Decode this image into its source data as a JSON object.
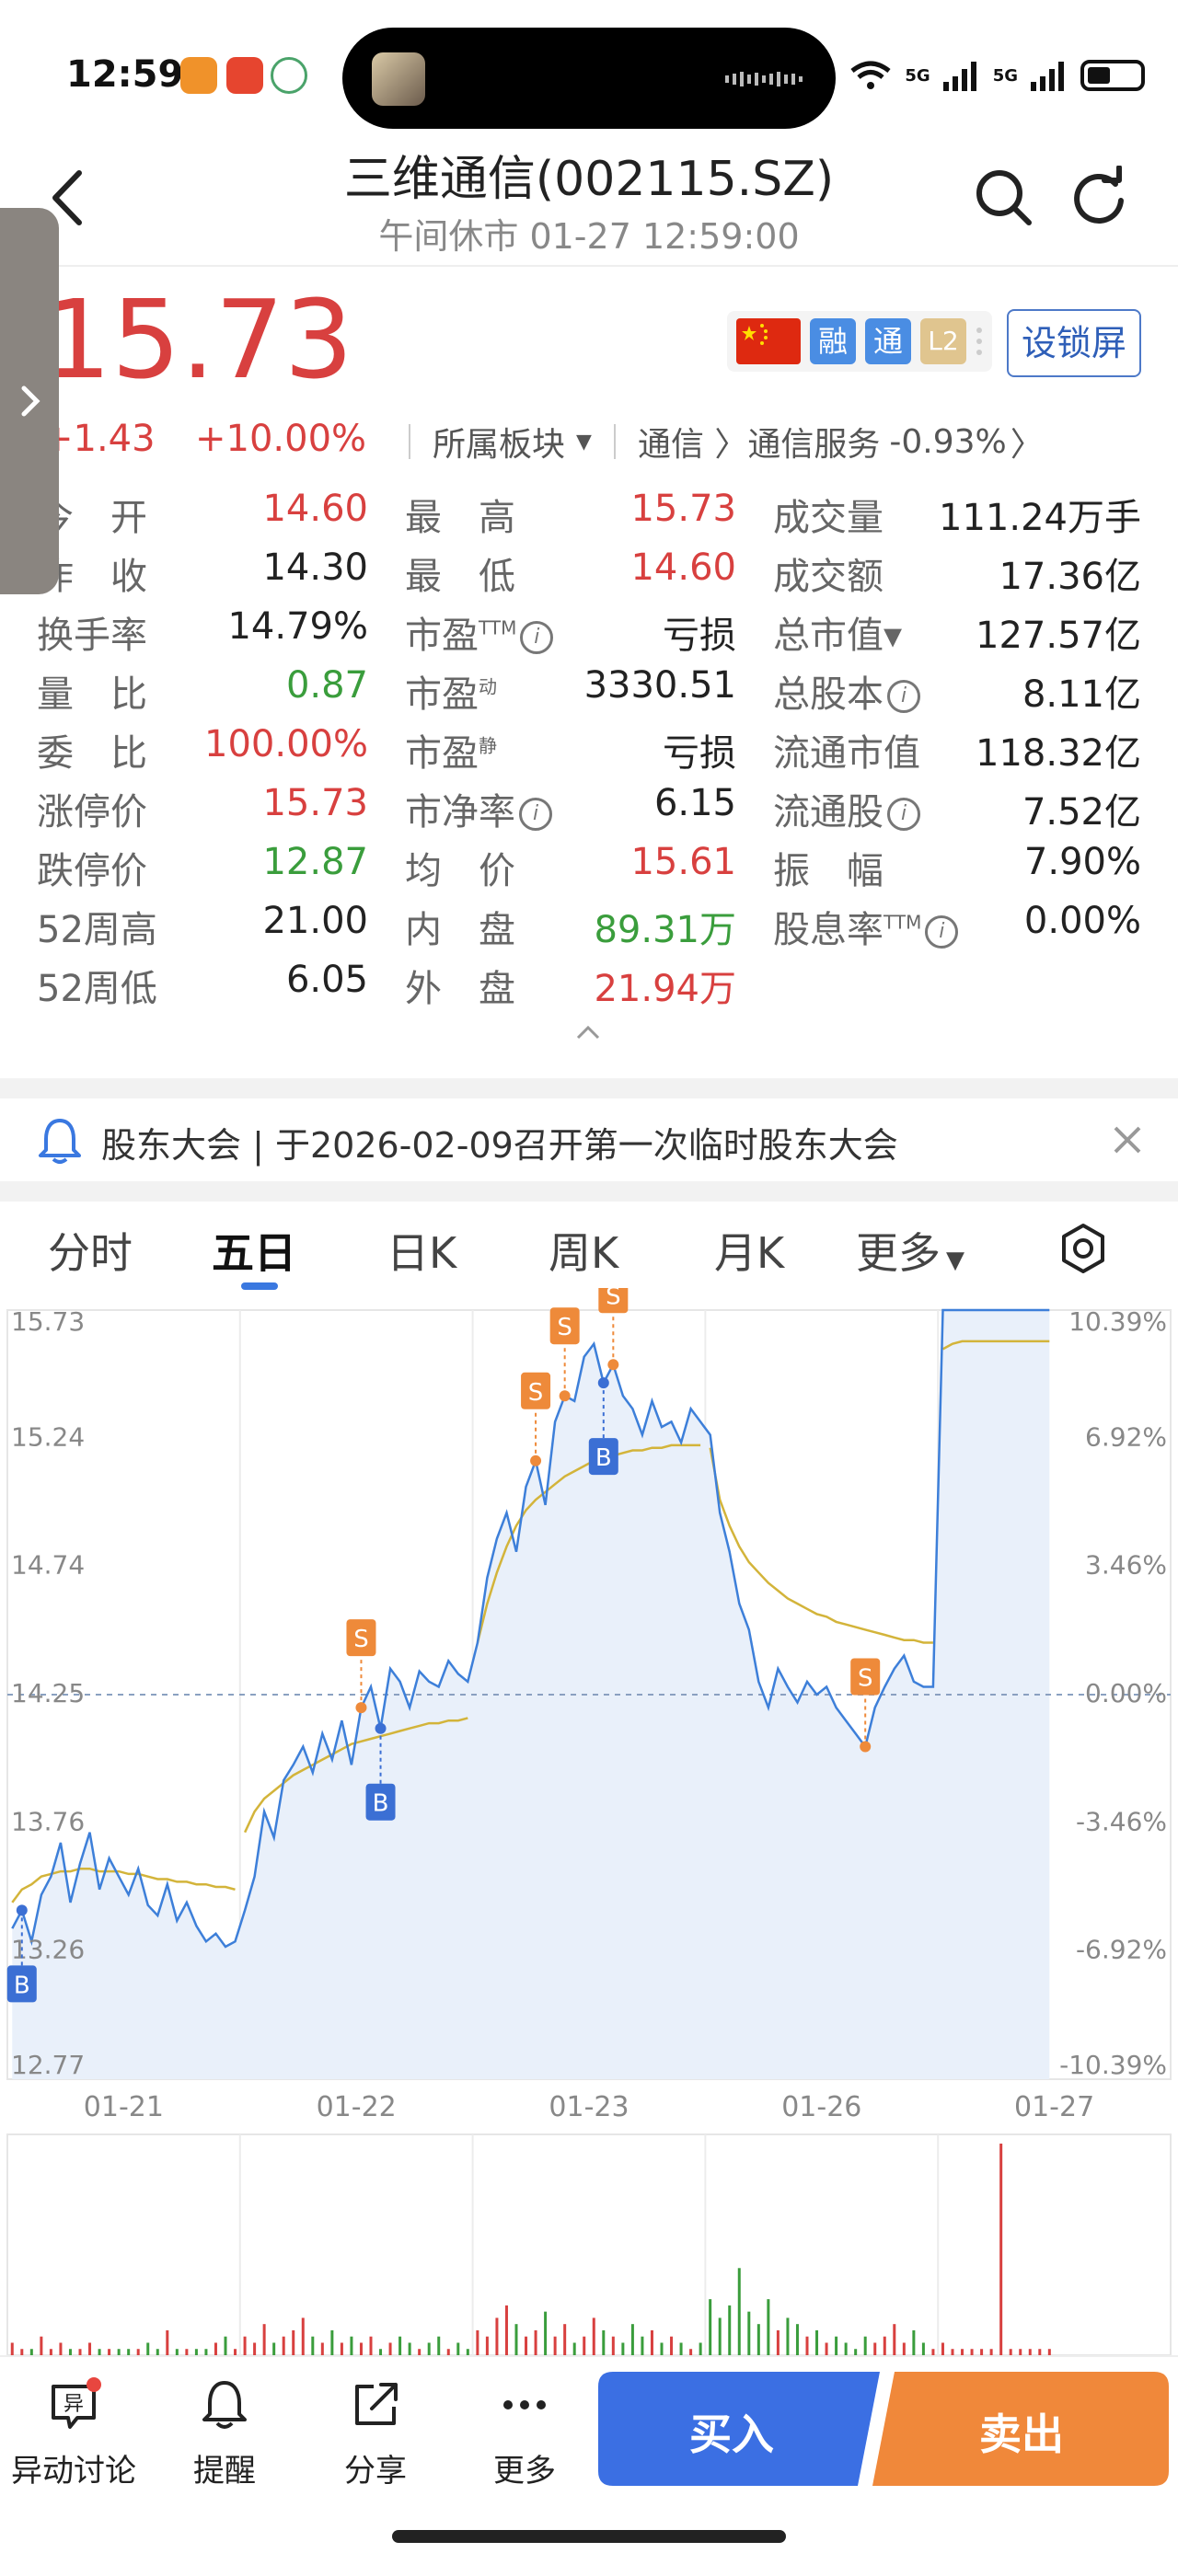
{
  "status_bar": {
    "time": "12:59",
    "network_labels": [
      "5G",
      "5G"
    ]
  },
  "header": {
    "title": "三维通信(002115.SZ)",
    "subtitle": "午间休市 01-27 12:59:00"
  },
  "quote": {
    "price": "15.73",
    "change": "+1.43",
    "change_pct": "+10.00%",
    "sector_label": "所属板块",
    "sector_path": "通信 〉通信服务",
    "sector_change": "-0.93%",
    "badges": [
      "融",
      "通",
      "L2"
    ],
    "set_lock_label": "设锁屏"
  },
  "stats": {
    "col1": [
      {
        "label": "今　开",
        "value": "14.60",
        "color": "red"
      },
      {
        "label": "昨　收",
        "value": "14.30",
        "color": "black"
      },
      {
        "label": "换手率",
        "value": "14.79%",
        "color": "black"
      },
      {
        "label": "量　比",
        "value": "0.87",
        "color": "green"
      },
      {
        "label": "委　比",
        "value": "100.00%",
        "color": "red"
      },
      {
        "label": "涨停价",
        "value": "15.73",
        "color": "red"
      },
      {
        "label": "跌停价",
        "value": "12.87",
        "color": "green"
      },
      {
        "label": "52周高",
        "value": "21.00",
        "color": "black"
      },
      {
        "label": "52周低",
        "value": "6.05",
        "color": "black"
      }
    ],
    "col2": [
      {
        "label": "最　高",
        "value": "15.73",
        "color": "red"
      },
      {
        "label": "最　低",
        "value": "14.60",
        "color": "red"
      },
      {
        "label": "市盈",
        "sup": "TTM",
        "info": true,
        "value": "亏损",
        "color": "black"
      },
      {
        "label": "市盈",
        "sup": "动",
        "value": "3330.51",
        "color": "black"
      },
      {
        "label": "市盈",
        "sup": "静",
        "value": "亏损",
        "color": "black"
      },
      {
        "label": "市净率",
        "info": true,
        "value": "6.15",
        "color": "black"
      },
      {
        "label": "均　价",
        "value": "15.61",
        "color": "red"
      },
      {
        "label": "内　盘",
        "value": "89.31万",
        "color": "green"
      },
      {
        "label": "外　盘",
        "value": "21.94万",
        "color": "red"
      }
    ],
    "col3": [
      {
        "label": "成交量",
        "value": "111.24万手",
        "color": "black"
      },
      {
        "label": "成交额",
        "value": "17.36亿",
        "color": "black"
      },
      {
        "label": "总市值▾",
        "value": "127.57亿",
        "color": "black"
      },
      {
        "label": "总股本",
        "info": true,
        "value": "8.11亿",
        "color": "black"
      },
      {
        "label": "流通市值",
        "value": "118.32亿",
        "color": "black"
      },
      {
        "label": "流通股",
        "info": true,
        "value": "7.52亿",
        "color": "black"
      },
      {
        "label": "振　幅",
        "value": "7.90%",
        "color": "black"
      },
      {
        "label": "股息率",
        "sup": "TTM",
        "info": true,
        "value": "0.00%",
        "color": "black"
      },
      {
        "label": "",
        "value": "",
        "color": "black"
      }
    ],
    "info_glyph": "i"
  },
  "notice": {
    "text": "股东大会 | 于2026-02-09召开第一次临时股东大会"
  },
  "tabs": [
    "分时",
    "五日",
    "日K",
    "周K",
    "月K",
    "更多"
  ],
  "active_tab": "五日",
  "chart_data": {
    "type": "line",
    "y_left_ticks": [
      "15.73",
      "15.24",
      "14.74",
      "14.25",
      "13.76",
      "13.26",
      "12.77"
    ],
    "y_right_ticks": [
      "10.39%",
      "6.92%",
      "3.46%",
      "0.00%",
      "-3.46%",
      "-6.92%",
      "-10.39%"
    ],
    "x_labels": [
      "01-21",
      "01-22",
      "01-23",
      "01-26",
      "01-27"
    ],
    "ylim": [
      12.77,
      15.73
    ],
    "prev_close": 14.25,
    "series": [
      {
        "values": [
          13.35,
          13.42,
          13.3,
          13.48,
          13.55,
          13.68,
          13.45,
          13.6,
          13.72,
          13.5,
          13.62,
          13.55,
          13.48,
          13.58,
          13.44,
          13.4,
          13.52,
          13.38,
          13.45,
          13.36,
          13.3,
          13.33,
          13.28,
          13.3,
          13.42,
          13.55,
          13.8,
          13.7,
          13.92,
          13.98,
          14.05,
          13.95,
          14.1,
          14.0,
          14.15,
          13.98,
          14.2,
          14.28,
          14.12,
          14.35,
          14.3,
          14.2,
          14.34,
          14.3,
          14.28,
          14.38,
          14.33,
          14.3,
          14.45,
          14.7,
          14.85,
          14.95,
          14.8,
          15.05,
          15.15,
          14.98,
          15.3,
          15.4,
          15.38,
          15.55,
          15.6,
          15.45,
          15.52,
          15.4,
          15.35,
          15.25,
          15.38,
          15.28,
          15.3,
          15.22,
          15.35,
          15.3,
          15.25,
          14.95,
          14.8,
          14.6,
          14.5,
          14.3,
          14.2,
          14.35,
          14.28,
          14.22,
          14.3,
          14.25,
          14.28,
          14.2,
          14.15,
          14.1,
          14.05,
          14.2,
          14.28,
          14.35,
          14.4,
          14.3,
          14.28,
          14.28,
          15.73,
          15.73,
          15.73,
          15.73,
          15.73,
          15.73,
          15.73,
          15.73,
          15.73,
          15.73,
          15.73,
          15.73
        ]
      },
      {
        "values": [
          13.45,
          13.5,
          13.52,
          13.55,
          13.56,
          13.57,
          13.57,
          13.58,
          13.58,
          13.57,
          13.57,
          13.57,
          13.56,
          13.56,
          13.55,
          13.54,
          13.54,
          13.53,
          13.53,
          13.52,
          13.52,
          13.51,
          13.51,
          13.5,
          13.72,
          13.8,
          13.85,
          13.88,
          13.91,
          13.94,
          13.96,
          13.98,
          14.0,
          14.02,
          14.04,
          14.06,
          14.07,
          14.08,
          14.09,
          14.1,
          14.11,
          14.12,
          14.13,
          14.14,
          14.14,
          14.15,
          14.15,
          14.16,
          14.45,
          14.6,
          14.72,
          14.82,
          14.9,
          14.96,
          15.0,
          15.03,
          15.06,
          15.09,
          15.11,
          15.13,
          15.15,
          15.16,
          15.17,
          15.18,
          15.19,
          15.19,
          15.2,
          15.2,
          15.21,
          15.21,
          15.21,
          15.21,
          15.2,
          15.0,
          14.9,
          14.82,
          14.76,
          14.72,
          14.68,
          14.65,
          14.62,
          14.6,
          14.58,
          14.56,
          14.55,
          14.53,
          14.52,
          14.51,
          14.5,
          14.49,
          14.48,
          14.47,
          14.46,
          14.46,
          14.45,
          14.45,
          15.58,
          15.6,
          15.61,
          15.61,
          15.61,
          15.61,
          15.61,
          15.61,
          15.61,
          15.61,
          15.61,
          15.61
        ]
      }
    ],
    "markers": [
      "B",
      "S",
      "B",
      "S",
      "S",
      "B",
      "S",
      "S"
    ],
    "volume": [
      2,
      1,
      1,
      3,
      1,
      2,
      1,
      1,
      2,
      1,
      1,
      1,
      1,
      1,
      2,
      1,
      4,
      1,
      1,
      1,
      1,
      2,
      3,
      1,
      3,
      2,
      5,
      2,
      3,
      4,
      6,
      3,
      2,
      4,
      2,
      3,
      2,
      3,
      1,
      2,
      3,
      2,
      1,
      2,
      3,
      1,
      2,
      1,
      4,
      3,
      6,
      8,
      5,
      3,
      4,
      7,
      3,
      5,
      2,
      3,
      6,
      4,
      3,
      2,
      5,
      3,
      4,
      2,
      3,
      2,
      1,
      2,
      9,
      6,
      8,
      14,
      7,
      5,
      9,
      4,
      6,
      5,
      3,
      4,
      2,
      3,
      2,
      1,
      3,
      2,
      3,
      5,
      2,
      4,
      2,
      1,
      2,
      1,
      1,
      1,
      1,
      1,
      34,
      1,
      1,
      1,
      1,
      1
    ]
  },
  "nav": [
    {
      "label": "异动讨论"
    },
    {
      "label": "提醒"
    },
    {
      "label": "分享"
    },
    {
      "label": "更多"
    }
  ],
  "buy_label": "买入",
  "sell_label": "卖出",
  "colors": {
    "up": "#d8403f",
    "down": "#3a9d3c",
    "price_line": "#3d7fd9",
    "avg_line": "#d3b43a",
    "buy_marker": "#3b6fd4",
    "sell_marker": "#ee8a3a",
    "buy_button": "#3b6fe3",
    "sell_button": "#f0883a"
  }
}
